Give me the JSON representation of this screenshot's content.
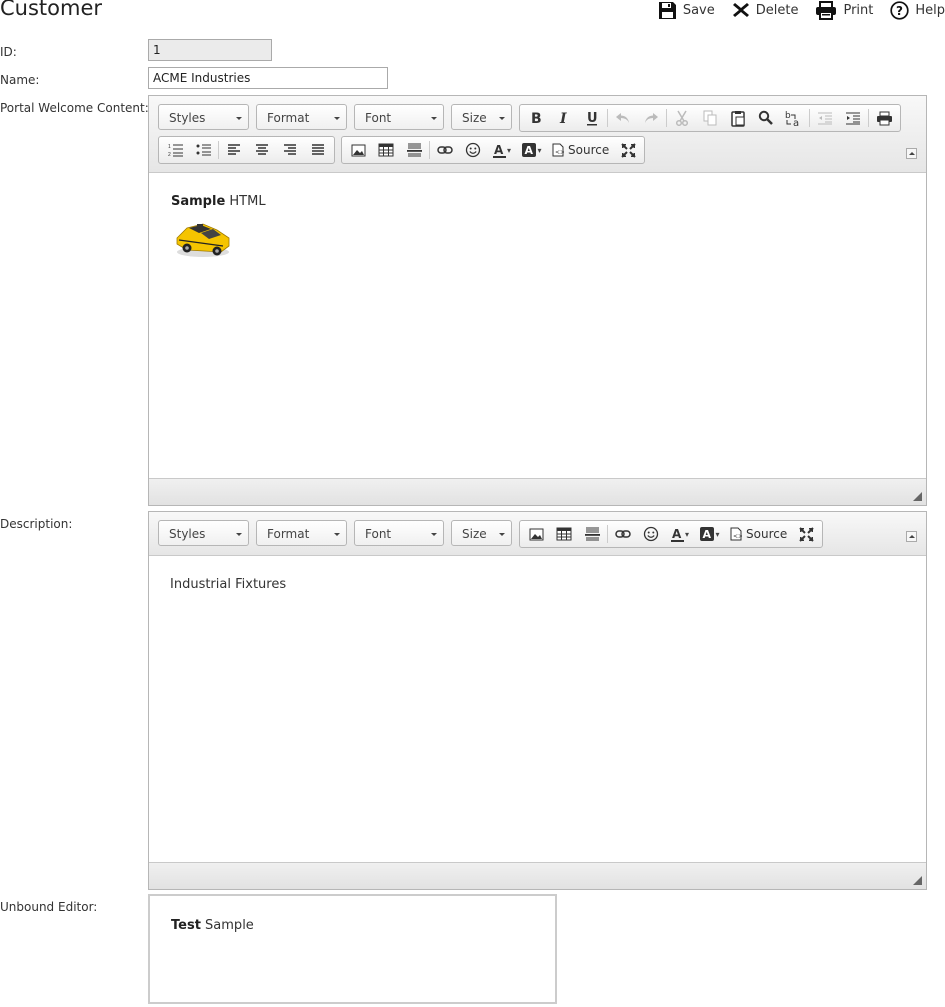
{
  "page": {
    "title": "Customer"
  },
  "toolbar": {
    "save": "Save",
    "delete": "Delete",
    "print": "Print",
    "help": "Help"
  },
  "fields": {
    "id_label": "ID:",
    "id_value": "1",
    "name_label": "Name:",
    "name_value": "ACME Industries",
    "portal_label": "Portal Welcome Content:",
    "description_label": "Description:",
    "unbound_label": "Unbound Editor:"
  },
  "editor": {
    "styles": "Styles",
    "format": "Format",
    "font": "Font",
    "size": "Size",
    "source": "Source"
  },
  "portal_content": {
    "bold": "Sample",
    "rest": " HTML"
  },
  "description_content": {
    "text": "Industrial Fixtures"
  },
  "unbound_content": {
    "bold": "Test",
    "rest": " Sample"
  },
  "colors": {
    "taxi": "#f5c400"
  }
}
